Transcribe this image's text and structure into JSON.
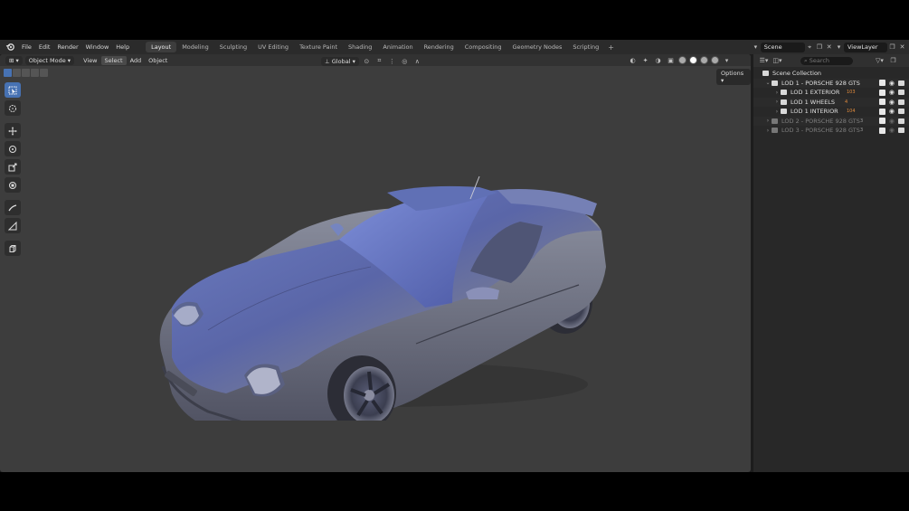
{
  "topbar": {
    "menu": [
      "File",
      "Edit",
      "Render",
      "Window",
      "Help"
    ],
    "workspaces": [
      "Layout",
      "Modeling",
      "Sculpting",
      "UV Editing",
      "Texture Paint",
      "Shading",
      "Animation",
      "Rendering",
      "Compositing",
      "Geometry Nodes",
      "Scripting"
    ],
    "active_workspace": "Layout",
    "add_workspace": "+",
    "scene": "Scene",
    "view_layer": "ViewLayer"
  },
  "viewport": {
    "mode": "Object Mode",
    "menu": [
      "View",
      "Select",
      "Add",
      "Object"
    ],
    "highlighted_menu": "Select",
    "transform_orientation": "Global",
    "options_label": "Options"
  },
  "toolbar": {
    "tools": [
      "select-box",
      "cursor",
      "move",
      "rotate",
      "scale",
      "transform",
      "annotate",
      "measure",
      "add-cube"
    ],
    "active_tool": "select-box"
  },
  "outliner": {
    "search_placeholder": "Search",
    "root": "Scene Collection",
    "rows": [
      {
        "label": "LOD 1 - PORSCHE 928 GTS",
        "dim": false,
        "level": 1,
        "expanded": true,
        "badge": ""
      },
      {
        "label": "LOD 1 EXTERIOR",
        "dim": false,
        "level": 2,
        "expanded": false,
        "badge": "103"
      },
      {
        "label": "LOD 1 WHEELS",
        "dim": false,
        "level": 2,
        "expanded": false,
        "badge": "4"
      },
      {
        "label": "LOD 1 INTERIOR",
        "dim": false,
        "level": 2,
        "expanded": false,
        "badge": "104"
      },
      {
        "label": "LOD 2 - PORSCHE 928 GTS",
        "dim": true,
        "level": 1,
        "expanded": false,
        "badge": "3"
      },
      {
        "label": "LOD 3 - PORSCHE 928 GTS",
        "dim": true,
        "level": 1,
        "expanded": false,
        "badge": "3"
      }
    ]
  },
  "colors": {
    "accent": "#4772b3",
    "viewport_bg": "#3d3d3d",
    "car_body": "#5a6a9e"
  }
}
